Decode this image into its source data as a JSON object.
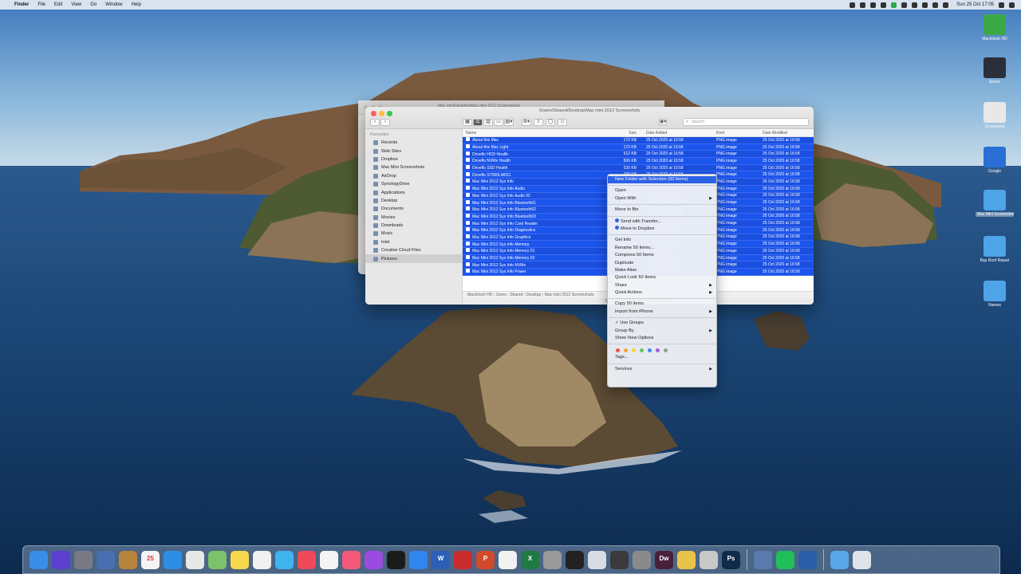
{
  "menubar": {
    "app_name": "Finder",
    "menus": [
      "File",
      "Edit",
      "View",
      "Go",
      "Window",
      "Help"
    ],
    "clock": "Sun 25 Oct  17:05"
  },
  "desktop_icons": [
    {
      "name": "drive-icon",
      "label": "Macintosh HD",
      "color": "#3aa845"
    },
    {
      "name": "server-icon",
      "label": "Server",
      "color": "#2b2f3a"
    },
    {
      "name": "document-icon",
      "label": "Screenshot",
      "color": "#e8e8e8"
    },
    {
      "name": "app-icon",
      "label": "Google",
      "color": "#2a6fd6"
    },
    {
      "name": "folder-icon",
      "label": "Mac Mini Screenshots",
      "color": "#4fa3e8"
    },
    {
      "name": "folder-icon",
      "label": "Bay Roof Repair",
      "color": "#4fa3e8"
    },
    {
      "name": "folder-icon",
      "label": "Names",
      "color": "#4fa3e8"
    }
  ],
  "finder": {
    "title": "/Users/Shared/Desktop/Mac mini 2012 Screenshots",
    "back_title": "Mac mini/Desktop/Mac mini 2012 Screenshots",
    "search_placeholder": "Search",
    "sidebar_section": "Favourites",
    "sidebar": [
      "Recents",
      "Web Sites",
      "Dropbox",
      "Mac Mini Screenshots",
      "AirDrop",
      "SynologyDrive",
      "Applications",
      "Desktop",
      "Documents",
      "Movies",
      "Downloads",
      "Music",
      "Intel",
      "Creative Cloud Files",
      "Pictures"
    ],
    "sidebar_active": 14,
    "columns": {
      "name": "Name",
      "size": "Size",
      "date_added": "Date Added",
      "kind": "Kind",
      "date_modified": "Date Modified"
    },
    "rows": [
      {
        "name": "About this Mac",
        "size": "172 KB",
        "date": "25 Oct 2020 at 16:58",
        "kind": "PNG image",
        "mod": "25 Oct 2020 at 16:58"
      },
      {
        "name": "About this Mac Light",
        "size": "173 KB",
        "date": "25 Oct 2020 at 16:58",
        "kind": "PNG image",
        "mod": "25 Oct 2020 at 16:58"
      },
      {
        "name": "Driveflo HDD Health",
        "size": "512 KB",
        "date": "25 Oct 2020 at 16:58",
        "kind": "PNG image",
        "mod": "25 Oct 2020 at 16:58"
      },
      {
        "name": "Driveflo NVMe Health",
        "size": "506 KB",
        "date": "25 Oct 2020 at 16:58",
        "kind": "PNG image",
        "mod": "25 Oct 2020 at 16:58"
      },
      {
        "name": "Driveflo SSD Health",
        "size": "520 KB",
        "date": "25 Oct 2020 at 16:58",
        "kind": "PNG image",
        "mod": "25 Oct 2020 at 16:58"
      },
      {
        "name": "Driveflo ST500LM021",
        "size": "498 KB",
        "date": "25 Oct 2020 at 16:58",
        "kind": "PNG image",
        "mod": "25 Oct 2020 at 16:58"
      },
      {
        "name": "Mac Mini 2012 Sys Info",
        "size": "389 KB",
        "date": "25 Oct 2020 at 16:58",
        "kind": "PNG image",
        "mod": "25 Oct 2020 at 16:58"
      },
      {
        "name": "Mac Mini 2012 Sys Info Audio",
        "size": "377 KB",
        "date": "25 Oct 2020 at 16:58",
        "kind": "PNG image",
        "mod": "25 Oct 2020 at 16:58"
      },
      {
        "name": "Mac Mini 2012 Sys Info Audio 02",
        "size": "380 KB",
        "date": "25 Oct 2020 at 16:58",
        "kind": "PNG image",
        "mod": "25 Oct 2020 at 16:58"
      },
      {
        "name": "Mac Mini 2012 Sys Info Bluetooth01",
        "size": "401 KB",
        "date": "25 Oct 2020 at 16:58",
        "kind": "PNG image",
        "mod": "25 Oct 2020 at 16:58"
      },
      {
        "name": "Mac Mini 2012 Sys Info Bluetooth02",
        "size": "399 KB",
        "date": "25 Oct 2020 at 16:58",
        "kind": "PNG image",
        "mod": "25 Oct 2020 at 16:58"
      },
      {
        "name": "Mac Mini 2012 Sys Info Bluetooth03",
        "size": "402 KB",
        "date": "25 Oct 2020 at 16:58",
        "kind": "PNG image",
        "mod": "25 Oct 2020 at 16:58"
      },
      {
        "name": "Mac Mini 2012 Sys Info Card Reader",
        "size": "354 KB",
        "date": "25 Oct 2020 at 16:58",
        "kind": "PNG image",
        "mod": "25 Oct 2020 at 16:58"
      },
      {
        "name": "Mac Mini 2012 Sys Info Diagnostics",
        "size": "361 KB",
        "date": "25 Oct 2020 at 16:58",
        "kind": "PNG image",
        "mod": "25 Oct 2020 at 16:58"
      },
      {
        "name": "Mac Mini 2012 Sys Info Graphics",
        "size": "388 KB",
        "date": "25 Oct 2020 at 16:58",
        "kind": "PNG image",
        "mod": "25 Oct 2020 at 16:58"
      },
      {
        "name": "Mac Mini 2012 Sys Info Memory",
        "size": "372 KB",
        "date": "25 Oct 2020 at 16:58",
        "kind": "PNG image",
        "mod": "25 Oct 2020 at 16:58"
      },
      {
        "name": "Mac Mini 2012 Sys Info Memory 01",
        "size": "375 KB",
        "date": "25 Oct 2020 at 16:58",
        "kind": "PNG image",
        "mod": "25 Oct 2020 at 16:58"
      },
      {
        "name": "Mac Mini 2012 Sys Info Memory 02",
        "size": "376 KB",
        "date": "25 Oct 2020 at 16:58",
        "kind": "PNG image",
        "mod": "25 Oct 2020 at 16:58"
      },
      {
        "name": "Mac Mini 2012 Sys Info NVMe",
        "size": "368 KB",
        "date": "25 Oct 2020 at 16:58",
        "kind": "PNG image",
        "mod": "25 Oct 2020 at 16:58"
      },
      {
        "name": "Mac Mini 2012 Sys Info Power",
        "size": "359 KB",
        "date": "25 Oct 2020 at 16:58",
        "kind": "PNG image",
        "mod": "25 Oct 2020 at 16:58"
      }
    ],
    "path": "Macintosh HD  ›  Users  ›  Shared  ›  Desktop  ›  Mac mini 2012 Screenshots",
    "status": "50 of 50 selected, 102.4 GB available"
  },
  "context_menu": {
    "items": [
      {
        "label": "New Folder with Selection (50 Items)",
        "highlight": true
      },
      {
        "sep": true
      },
      {
        "label": "Open"
      },
      {
        "label": "Open With",
        "submenu": true
      },
      {
        "sep": true
      },
      {
        "label": "Move to Bin"
      },
      {
        "sep": true
      },
      {
        "label": "Send with Transfer...",
        "icon": true
      },
      {
        "label": "Move to Dropbox",
        "icon": true
      },
      {
        "sep": true
      },
      {
        "label": "Get Info"
      },
      {
        "label": "Rename 50 Items..."
      },
      {
        "label": "Compress 50 Items"
      },
      {
        "label": "Duplicate"
      },
      {
        "label": "Make Alias"
      },
      {
        "label": "Quick Look 50 Items"
      },
      {
        "label": "Share",
        "submenu": true
      },
      {
        "label": "Quick Actions",
        "submenu": true
      },
      {
        "sep": true
      },
      {
        "label": "Copy 50 Items"
      },
      {
        "label": "Import from iPhone",
        "submenu": true
      },
      {
        "sep": true
      },
      {
        "label": "✓ Use Groups"
      },
      {
        "label": "Group By",
        "submenu": true
      },
      {
        "label": "Show View Options"
      },
      {
        "sep": true
      },
      {
        "tags": true
      },
      {
        "label": "Tags..."
      },
      {
        "sep": true
      },
      {
        "label": "Services",
        "submenu": true
      }
    ],
    "tag_colors": [
      "#f0524f",
      "#f5a33a",
      "#f3d83b",
      "#5cc95a",
      "#3f8ef0",
      "#a75ee0",
      "#9a9a9a"
    ]
  },
  "dock": [
    {
      "name": "finder-icon",
      "color": "#3a8ee8",
      "text": ""
    },
    {
      "name": "siri-icon",
      "color": "#5a3fd0",
      "text": ""
    },
    {
      "name": "launchpad-icon",
      "color": "#7a7a86",
      "text": ""
    },
    {
      "name": "preview-icon",
      "color": "#4a6fb0",
      "text": ""
    },
    {
      "name": "notes-app-icon",
      "color": "#b8843c",
      "text": ""
    },
    {
      "name": "calendar-icon",
      "color": "#f4f4f4",
      "text": "25"
    },
    {
      "name": "safari-icon",
      "color": "#2c8fe6",
      "text": ""
    },
    {
      "name": "chrome-icon",
      "color": "#e8e8e8",
      "text": ""
    },
    {
      "name": "maps-icon",
      "color": "#7cc26a",
      "text": ""
    },
    {
      "name": "stickies-icon",
      "color": "#f6d64a",
      "text": ""
    },
    {
      "name": "photos-icon",
      "color": "#f1f1f1",
      "text": ""
    },
    {
      "name": "messages-icon",
      "color": "#3fb4f0",
      "text": ""
    },
    {
      "name": "news-icon",
      "color": "#f04a5a",
      "text": ""
    },
    {
      "name": "reminders-icon",
      "color": "#f4f4f4",
      "text": ""
    },
    {
      "name": "music-icon",
      "color": "#f45a7a",
      "text": ""
    },
    {
      "name": "podcasts-icon",
      "color": "#9a4ae0",
      "text": ""
    },
    {
      "name": "tv-icon",
      "color": "#1b1b1b",
      "text": ""
    },
    {
      "name": "app-store-icon",
      "color": "#2f86f0",
      "text": ""
    },
    {
      "name": "word-icon",
      "color": "#2b5fb8",
      "text": "W"
    },
    {
      "name": "zotero-icon",
      "color": "#cc2b2b",
      "text": ""
    },
    {
      "name": "powerpoint-icon",
      "color": "#d24a2b",
      "text": "P"
    },
    {
      "name": "textedit-icon",
      "color": "#f2f2f2",
      "text": ""
    },
    {
      "name": "excel-icon",
      "color": "#1f7a44",
      "text": "X"
    },
    {
      "name": "disk-utility-icon",
      "color": "#9a9a9a",
      "text": ""
    },
    {
      "name": "terminal-icon",
      "color": "#222",
      "text": ""
    },
    {
      "name": "mail-icon",
      "color": "#d8dde4",
      "text": ""
    },
    {
      "name": "screenshot-icon",
      "color": "#3a3a3a",
      "text": ""
    },
    {
      "name": "system-prefs-icon",
      "color": "#8a8a8a",
      "text": ""
    },
    {
      "name": "dreamweaver-icon",
      "color": "#4a1f3a",
      "text": "Dw"
    },
    {
      "name": "vpn-icon",
      "color": "#e8c34a",
      "text": ""
    },
    {
      "name": "archive-icon",
      "color": "#c9c9c9",
      "text": ""
    },
    {
      "name": "photoshop-icon",
      "color": "#0f2b4a",
      "text": "Ps"
    },
    {
      "sep": true
    },
    {
      "name": "server-app-icon",
      "color": "#5b7ab0",
      "text": ""
    },
    {
      "name": "spotify-icon",
      "color": "#1fbf5a",
      "text": ""
    },
    {
      "name": "quicktime-icon",
      "color": "#2a5fa8",
      "text": ""
    },
    {
      "sep": true
    },
    {
      "name": "downloads-folder-icon",
      "color": "#5aa6e8",
      "text": ""
    },
    {
      "name": "trash-icon",
      "color": "#dfe4ea",
      "text": ""
    }
  ]
}
